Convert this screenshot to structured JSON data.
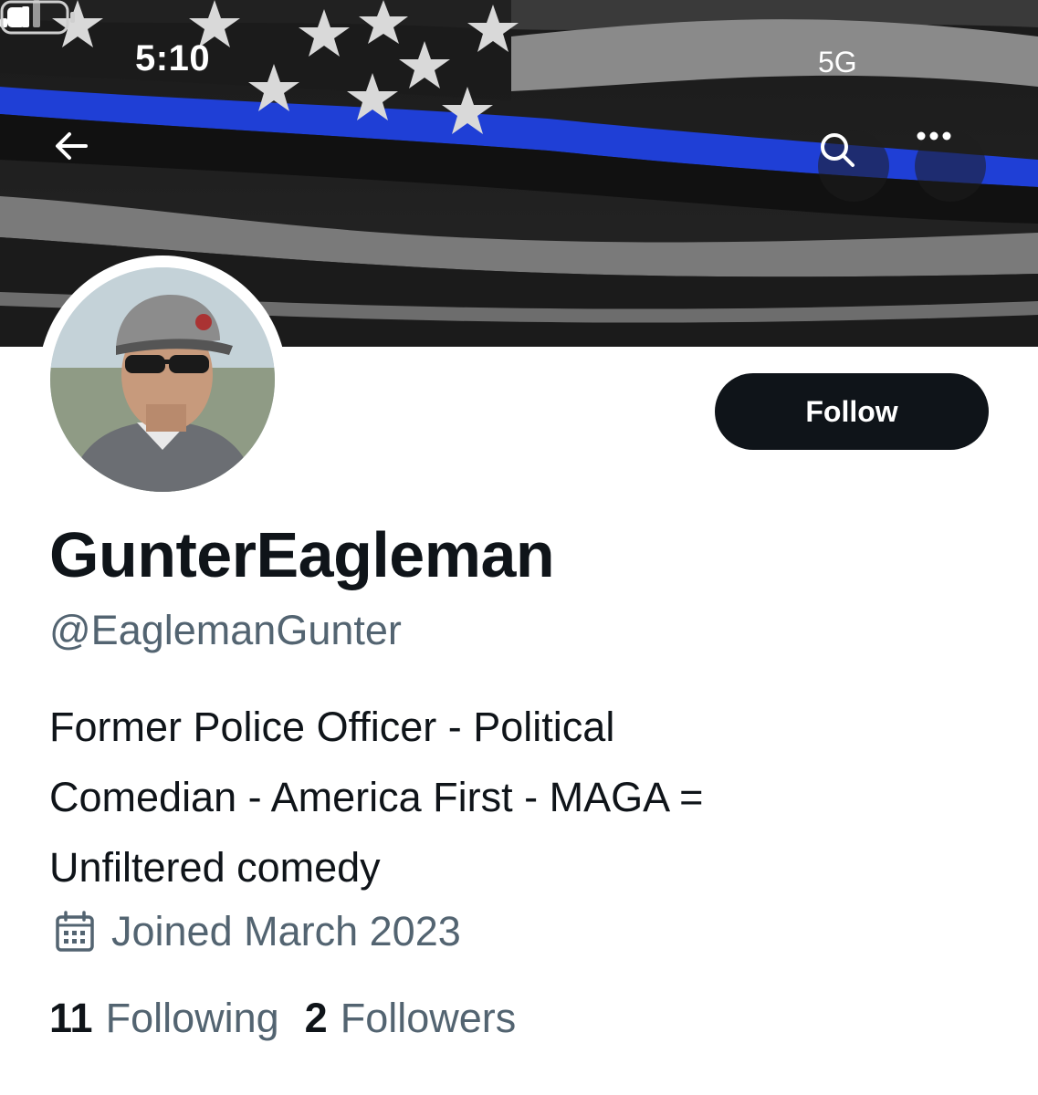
{
  "status_bar": {
    "time": "5:10",
    "network": "5G"
  },
  "nav": {
    "back_icon": "arrow-left-icon",
    "search_icon": "search-icon",
    "more_icon": "more-dots-icon"
  },
  "colors": {
    "flag_blue": "#1f3fd6",
    "follow_button_bg": "#0f1419",
    "secondary_text": "#536471"
  },
  "profile": {
    "follow_label": "Follow",
    "display_name": "GunterEagleman",
    "handle": "@EaglemanGunter",
    "bio_lines": [
      "Former Police Officer - Political",
      "Comedian - America First - MAGA =",
      "Unfiltered comedy"
    ],
    "joined": "Joined March 2023",
    "following_count": "11",
    "following_label": "Following",
    "followers_count": "2",
    "followers_label": "Followers"
  }
}
